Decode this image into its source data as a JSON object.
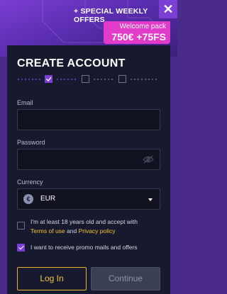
{
  "banner": {
    "offers_label": "+ SPECIAL WEEKLY OFFERS",
    "close_symbol": "✕",
    "welcome_line1": "Welcome pack",
    "welcome_line2": "750€ +75FS"
  },
  "modal": {
    "title": "CREATE ACCOUNT",
    "steps": {
      "total": 4,
      "current": 1,
      "completed": [
        1
      ]
    },
    "email": {
      "label": "Email",
      "value": "",
      "placeholder": ""
    },
    "password": {
      "label": "Password",
      "value": "",
      "placeholder": ""
    },
    "currency": {
      "label": "Currency",
      "icon_symbol": "€",
      "value": "EUR"
    },
    "terms": {
      "checked": false,
      "text_before": "I'm at least 18 years old and accept with",
      "terms_link": "Terms of use",
      "and_text": " and ",
      "privacy_link": "Privacy policy"
    },
    "promo": {
      "checked": true,
      "text": "I want to receive promo mails and offers"
    },
    "login_label": "Log In",
    "continue_label": "Continue"
  },
  "colors": {
    "accent": "#7b3fd6",
    "link": "#f2c43a",
    "pink": "#e23ac9",
    "panel": "#171a2e"
  }
}
